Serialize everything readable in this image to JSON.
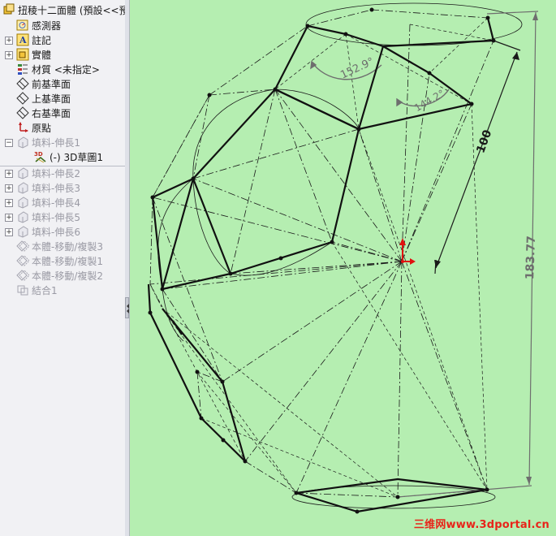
{
  "feature_tree": {
    "root": "扭稜十二面體 (預設<<預",
    "items": [
      {
        "label": "感測器",
        "icon": "sensor-icon",
        "dim": false
      },
      {
        "label": "註記",
        "icon": "annotation-icon",
        "dim": false
      },
      {
        "label": "實體",
        "icon": "solid-bodies-icon",
        "dim": false
      },
      {
        "label": "材質 <未指定>",
        "icon": "material-icon",
        "dim": false
      },
      {
        "label": "前基準面",
        "icon": "plane-icon",
        "dim": false
      },
      {
        "label": "上基準面",
        "icon": "plane-icon",
        "dim": false
      },
      {
        "label": "右基準面",
        "icon": "plane-icon",
        "dim": false
      },
      {
        "label": "原點",
        "icon": "origin-icon",
        "dim": false
      },
      {
        "label": "填料-伸長1",
        "icon": "extrude-icon",
        "dim": true
      },
      {
        "label": "(-) 3D草圖1",
        "icon": "sketch3d-icon",
        "dim": false
      },
      {
        "label": "填料-伸長2",
        "icon": "extrude-icon",
        "dim": true
      },
      {
        "label": "填料-伸長3",
        "icon": "extrude-icon",
        "dim": true
      },
      {
        "label": "填料-伸長4",
        "icon": "extrude-icon",
        "dim": true
      },
      {
        "label": "填料-伸長5",
        "icon": "extrude-icon",
        "dim": true
      },
      {
        "label": "填料-伸長6",
        "icon": "extrude-icon",
        "dim": true
      },
      {
        "label": "本體-移動/複製3",
        "icon": "move-copy-icon",
        "dim": true
      },
      {
        "label": "本體-移動/複製1",
        "icon": "move-copy-icon",
        "dim": true
      },
      {
        "label": "本體-移動/複製2",
        "icon": "move-copy-icon",
        "dim": true
      },
      {
        "label": "結合1",
        "icon": "combine-icon",
        "dim": true
      }
    ]
  },
  "sketch3d_badge": "3D",
  "dimensions": {
    "angle_1": "152.9°",
    "angle_2": "144.2°",
    "length_1": "100",
    "length_2": "183.77"
  },
  "watermark": "三维网www.3dportal.cn",
  "colors": {
    "viewport_bg": "#b5eeb1",
    "dimension_text": "#6e6e6e",
    "watermark": "#e8241a",
    "origin_triad": "#e01010"
  }
}
